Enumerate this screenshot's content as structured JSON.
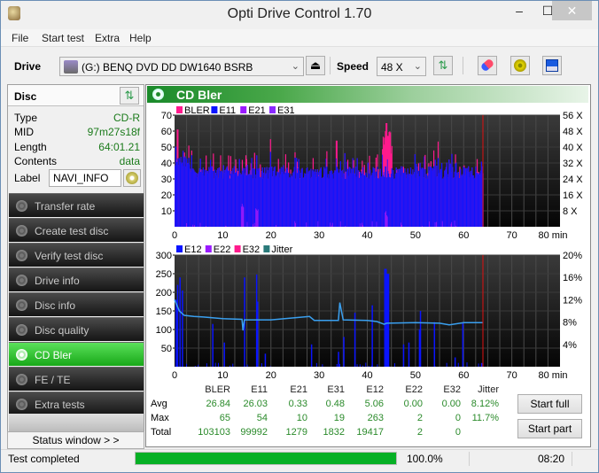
{
  "window": {
    "title": "Opti Drive Control 1.70",
    "minimize": "‒",
    "maximize": "☐",
    "close": "✕"
  },
  "menu": [
    "File",
    "Start test",
    "Extra",
    "Help"
  ],
  "toolbar": {
    "drive_label": "Drive",
    "drive_value": "(G:)  BENQ DVD DD DW1640 BSRB",
    "speed_label": "Speed",
    "speed_value": "48 X",
    "eject_icon": "⏏",
    "refresh_icon": "⇅",
    "erase_icon": "eraser-icon",
    "options_icon": "options-icon",
    "save_icon": "save-icon"
  },
  "disc": {
    "header": "Disc",
    "rows": [
      {
        "key": "Type",
        "value": "CD-R"
      },
      {
        "key": "MID",
        "value": "97m27s18f"
      },
      {
        "key": "Length",
        "value": "64:01.21"
      },
      {
        "key": "Contents",
        "value": "data"
      }
    ],
    "label_key": "Label",
    "label_value": "NAVI_INFO"
  },
  "nav": [
    {
      "label": "Transfer rate",
      "active": false
    },
    {
      "label": "Create test disc",
      "active": false
    },
    {
      "label": "Verify test disc",
      "active": false
    },
    {
      "label": "Drive info",
      "active": false
    },
    {
      "label": "Disc info",
      "active": false
    },
    {
      "label": "Disc quality",
      "active": false
    },
    {
      "label": "CD Bler",
      "active": true
    },
    {
      "label": "FE / TE",
      "active": false
    },
    {
      "label": "Extra tests",
      "active": false
    }
  ],
  "status_window_button": "Status window > >",
  "main": {
    "title": "CD Bler"
  },
  "chart_data": [
    {
      "type": "bar",
      "title": "CD Bler - upper",
      "legend": [
        {
          "name": "BLER",
          "color": "#ff1a8c"
        },
        {
          "name": "E11",
          "color": "#0a14ff"
        },
        {
          "name": "E21",
          "color": "#9a1aff"
        },
        {
          "name": "E31",
          "color": "#8a2aff"
        }
      ],
      "xlabel": "min",
      "x_ticks": [
        "0",
        "10",
        "20",
        "30",
        "40",
        "50",
        "60",
        "70",
        "80 min"
      ],
      "xlim": [
        0,
        80
      ],
      "ylim": [
        0,
        70
      ],
      "y_ticks": [
        "10",
        "20",
        "30",
        "40",
        "50",
        "60",
        "70"
      ],
      "y2_ticks": [
        "8 X",
        "16 X",
        "24 X",
        "32 X",
        "40 X",
        "48 X",
        "56 X"
      ],
      "y2lim": [
        0,
        56
      ],
      "end_marker_min": 64.0,
      "series_summary": {
        "E11_typical": [
          30,
          40
        ],
        "BLER_peaks": [
          {
            "x": 0.5,
            "y": 61
          },
          {
            "x": 43.8,
            "y": 65
          },
          {
            "x": 44.2,
            "y": 57
          },
          {
            "x": 33.5,
            "y": 54
          }
        ],
        "E21_peaks": [
          {
            "x": 14,
            "y": 16
          },
          {
            "x": 17,
            "y": 15
          },
          {
            "x": 43.8,
            "y": 10
          }
        ]
      },
      "grid": true
    },
    {
      "type": "bar",
      "title": "CD Bler - lower",
      "legend": [
        {
          "name": "E12",
          "color": "#0a14ff"
        },
        {
          "name": "E22",
          "color": "#9a1aff"
        },
        {
          "name": "E32",
          "color": "#ff1a8c"
        },
        {
          "name": "Jitter",
          "color": "#2a7a7a"
        }
      ],
      "xlabel": "min",
      "x_ticks": [
        "0",
        "10",
        "20",
        "30",
        "40",
        "50",
        "60",
        "70",
        "80 min"
      ],
      "xlim": [
        0,
        80
      ],
      "ylim": [
        0,
        300
      ],
      "y_ticks": [
        "50",
        "100",
        "150",
        "200",
        "250",
        "300"
      ],
      "y2_ticks": [
        "4%",
        "8%",
        "12%",
        "16%",
        "20%"
      ],
      "y2lim": [
        0,
        20
      ],
      "end_marker_min": 64.0,
      "E12_spikes": [
        {
          "x": 0.2,
          "y": 180
        },
        {
          "x": 0.5,
          "y": 220
        },
        {
          "x": 1.0,
          "y": 240
        },
        {
          "x": 1.5,
          "y": 205
        },
        {
          "x": 7.8,
          "y": 115
        },
        {
          "x": 10.2,
          "y": 65
        },
        {
          "x": 14.4,
          "y": 240
        },
        {
          "x": 16.9,
          "y": 248
        },
        {
          "x": 17.1,
          "y": 175
        },
        {
          "x": 18.7,
          "y": 35
        },
        {
          "x": 28.3,
          "y": 60
        },
        {
          "x": 33.9,
          "y": 40
        },
        {
          "x": 35.0,
          "y": 80
        },
        {
          "x": 37.3,
          "y": 145
        },
        {
          "x": 40.9,
          "y": 165
        },
        {
          "x": 43.5,
          "y": 263
        },
        {
          "x": 44.0,
          "y": 250
        },
        {
          "x": 47.4,
          "y": 60
        },
        {
          "x": 48.5,
          "y": 65
        },
        {
          "x": 50.7,
          "y": 100
        },
        {
          "x": 50.9,
          "y": 150
        },
        {
          "x": 53.8,
          "y": 120
        },
        {
          "x": 58.1,
          "y": 25
        },
        {
          "x": 59.7,
          "y": 120
        },
        {
          "x": 63.6,
          "y": 10
        }
      ],
      "jitter_percent": [
        {
          "x": 0,
          "y": 12.0
        },
        {
          "x": 1,
          "y": 10.0
        },
        {
          "x": 2,
          "y": 9.2
        },
        {
          "x": 4,
          "y": 9.0
        },
        {
          "x": 6,
          "y": 8.9
        },
        {
          "x": 10,
          "y": 8.6
        },
        {
          "x": 14,
          "y": 8.5
        },
        {
          "x": 14.2,
          "y": 6.5
        },
        {
          "x": 14.5,
          "y": 8.4
        },
        {
          "x": 20,
          "y": 8.4
        },
        {
          "x": 28,
          "y": 9.0
        },
        {
          "x": 29,
          "y": 8.3
        },
        {
          "x": 34,
          "y": 8.3
        },
        {
          "x": 34.3,
          "y": 11.5
        },
        {
          "x": 35,
          "y": 8.4
        },
        {
          "x": 40,
          "y": 8.3
        },
        {
          "x": 42,
          "y": 8.1
        },
        {
          "x": 43.5,
          "y": 7.6
        },
        {
          "x": 44,
          "y": 7.8
        },
        {
          "x": 50,
          "y": 7.9
        },
        {
          "x": 55,
          "y": 7.8
        },
        {
          "x": 57,
          "y": 7.5
        },
        {
          "x": 60,
          "y": 7.9
        },
        {
          "x": 64,
          "y": 7.9
        }
      ],
      "grid": true
    }
  ],
  "stats": {
    "columns": [
      "BLER",
      "E11",
      "E21",
      "E31",
      "E12",
      "E22",
      "E32",
      "Jitter"
    ],
    "rows": [
      {
        "label": "Avg",
        "values": [
          "26.84",
          "26.03",
          "0.33",
          "0.48",
          "5.06",
          "0.00",
          "0.00",
          "8.12%"
        ]
      },
      {
        "label": "Max",
        "values": [
          "65",
          "54",
          "10",
          "19",
          "263",
          "2",
          "0",
          "11.7%"
        ]
      },
      {
        "label": "Total",
        "values": [
          "103103",
          "99992",
          "1279",
          "1832",
          "19417",
          "2",
          "0",
          ""
        ]
      }
    ]
  },
  "buttons": {
    "start_full": "Start full",
    "start_part": "Start part"
  },
  "statusbar": {
    "text": "Test completed",
    "progress_percent": 100.0,
    "progress_label": "100.0%",
    "time": "08:20"
  }
}
